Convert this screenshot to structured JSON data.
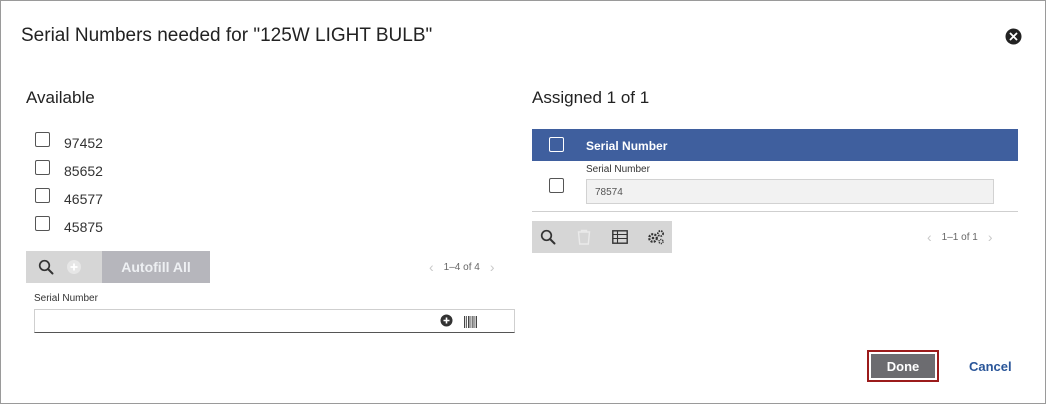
{
  "dialog": {
    "title": "Serial Numbers needed for \"125W LIGHT BULB\"",
    "close_icon": "close-circle-icon"
  },
  "available": {
    "heading": "Available",
    "items": [
      {
        "serial": "97452"
      },
      {
        "serial": "85652"
      },
      {
        "serial": "46577"
      },
      {
        "serial": "45875"
      }
    ],
    "toolbar": {
      "search_icon": "search-icon",
      "add_icon": "add-circle-icon",
      "autofill_label": "Autofill All"
    },
    "pager": "1–4 of 4",
    "serial_field": {
      "label": "Serial Number",
      "value": ""
    }
  },
  "assigned": {
    "heading": "Assigned 1 of 1",
    "grid": {
      "header": "Serial Number",
      "rows": [
        {
          "label": "Serial Number",
          "value": "78574"
        }
      ]
    },
    "toolbar": {
      "search_icon": "search-icon",
      "delete_icon": "trash-icon",
      "columns_icon": "table-columns-icon",
      "settings_icon": "gears-icon"
    },
    "pager": "1–1 of 1"
  },
  "footer": {
    "done_label": "Done",
    "cancel_label": "Cancel"
  },
  "colors": {
    "header_blue": "#3f5f9e",
    "done_border": "#9b1b1b",
    "link_blue": "#2a5699"
  }
}
